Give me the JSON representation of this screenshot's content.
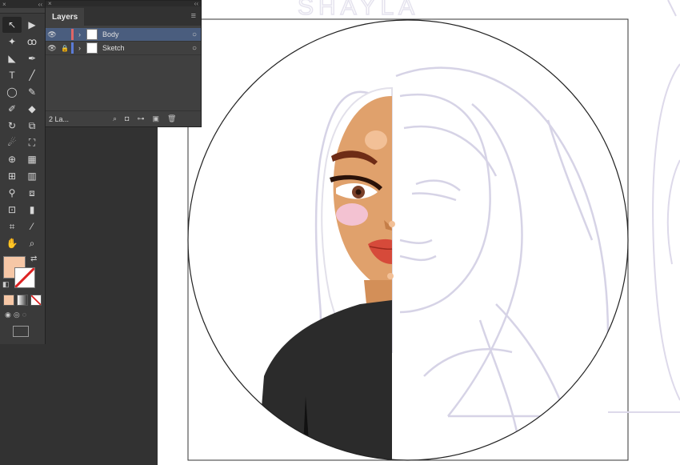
{
  "window": {
    "collapse_glyph": "‹‹",
    "close_glyph": "×"
  },
  "layers_panel": {
    "tab_label": "Layers",
    "layers": [
      {
        "name": "Body",
        "visible": true,
        "locked": false,
        "selected": true,
        "color": "#e06666"
      },
      {
        "name": "Sketch",
        "visible": true,
        "locked": true,
        "selected": false,
        "color": "#5b7bd5"
      }
    ],
    "footer_count": "2 La...",
    "icons": [
      "locate-object-icon",
      "make-clipping-mask-icon",
      "create-sublayer-icon",
      "create-new-layer-icon",
      "delete-layer-icon"
    ]
  },
  "tools": {
    "items": [
      {
        "name": "selection-tool",
        "glyph": "↖",
        "selected": true
      },
      {
        "name": "direct-selection-tool",
        "glyph": "▶",
        "selected": false
      },
      {
        "name": "magic-wand-tool",
        "glyph": "✦",
        "selected": false
      },
      {
        "name": "lasso-tool",
        "glyph": "ꝏ",
        "selected": false
      },
      {
        "name": "direct-select-curve-tool",
        "glyph": "◣",
        "selected": false
      },
      {
        "name": "pen-tool",
        "glyph": "✒",
        "selected": false
      },
      {
        "name": "type-tool",
        "glyph": "T",
        "selected": false
      },
      {
        "name": "line-segment-tool",
        "glyph": "╱",
        "selected": false
      },
      {
        "name": "ellipse-tool",
        "glyph": "◯",
        "selected": false
      },
      {
        "name": "paintbrush-tool",
        "glyph": "✎",
        "selected": false
      },
      {
        "name": "shaper-tool",
        "glyph": "✐",
        "selected": false
      },
      {
        "name": "eraser-tool",
        "glyph": "◆",
        "selected": false
      },
      {
        "name": "rotate-tool",
        "glyph": "↻",
        "selected": false
      },
      {
        "name": "scale-tool",
        "glyph": "⧉",
        "selected": false
      },
      {
        "name": "warp-tool",
        "glyph": "☄",
        "selected": false
      },
      {
        "name": "free-transform-tool",
        "glyph": "⛶",
        "selected": false
      },
      {
        "name": "shape-builder-tool",
        "glyph": "⊕",
        "selected": false
      },
      {
        "name": "perspective-grid-tool",
        "glyph": "▦",
        "selected": false
      },
      {
        "name": "mesh-tool",
        "glyph": "⊞",
        "selected": false
      },
      {
        "name": "gradient-tool",
        "glyph": "▥",
        "selected": false
      },
      {
        "name": "eyedropper-tool",
        "glyph": "⚲",
        "selected": false
      },
      {
        "name": "blend-tool",
        "glyph": "⧈",
        "selected": false
      },
      {
        "name": "symbol-sprayer-tool",
        "glyph": "⊡",
        "selected": false
      },
      {
        "name": "column-graph-tool",
        "glyph": "▮",
        "selected": false
      },
      {
        "name": "artboard-tool",
        "glyph": "⌗",
        "selected": false
      },
      {
        "name": "slice-tool",
        "glyph": "⁄",
        "selected": false
      },
      {
        "name": "hand-tool",
        "glyph": "✋",
        "selected": false
      },
      {
        "name": "zoom-tool",
        "glyph": "⌕",
        "selected": false
      }
    ],
    "fill_color": "#f6c7a6",
    "stroke_color": "none"
  },
  "canvas": {
    "sketch_text": "SHAYLA",
    "skin_color": "#e0a16c",
    "shirt_color": "#2b2b2b",
    "hair_color": "#ffffff",
    "sketch_color": "#d6d3e6"
  }
}
